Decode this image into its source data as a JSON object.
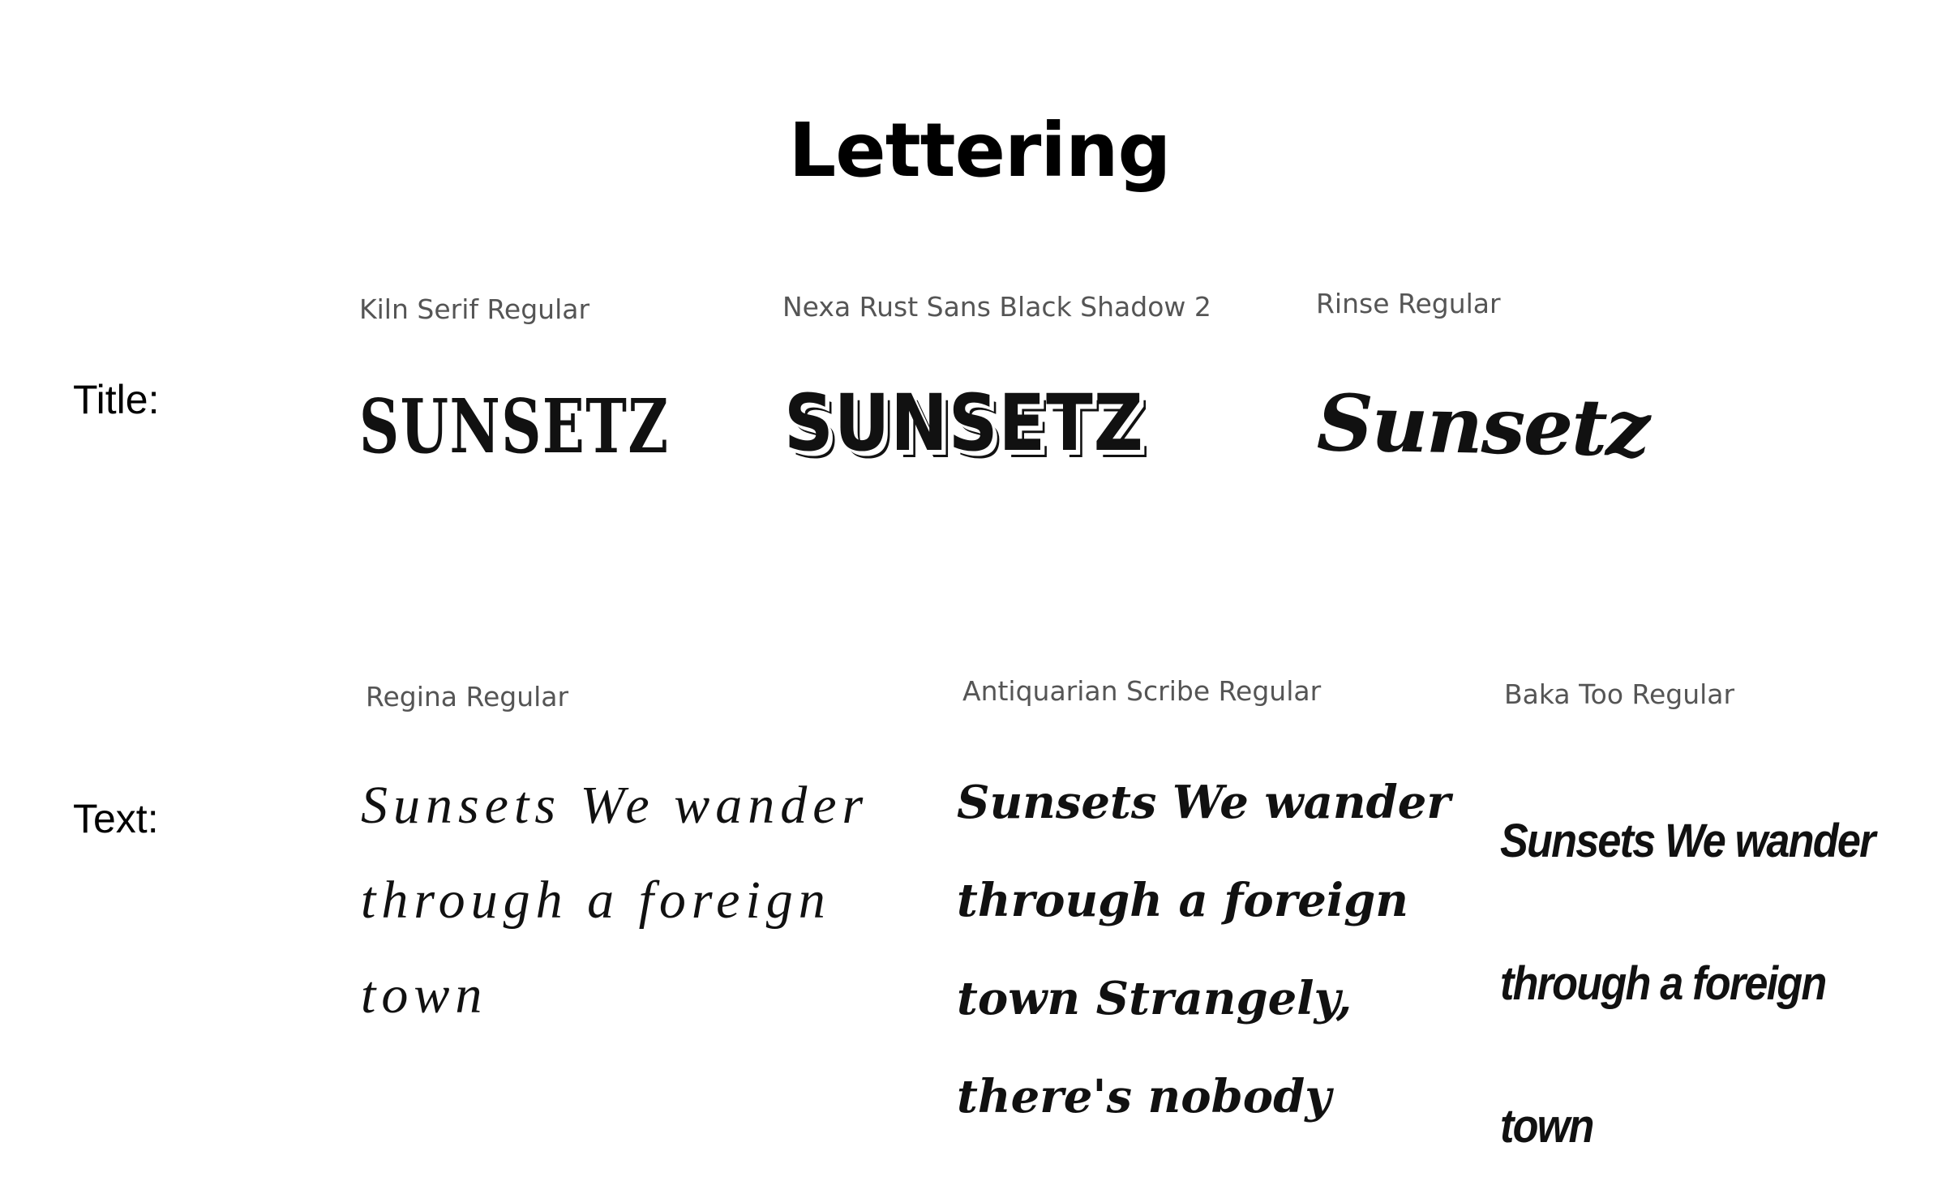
{
  "title": "Lettering",
  "rows": {
    "title_row": {
      "label": "Title:",
      "fonts": [
        {
          "name": "Kiln Serif Regular",
          "sample": "SUNSETZ"
        },
        {
          "name": "Nexa Rust Sans Black Shadow 2",
          "sample": "SUNSETZ"
        },
        {
          "name": "Rinse Regular",
          "sample": "Sunsetz"
        }
      ]
    },
    "text_row": {
      "label": "Text:",
      "fonts": [
        {
          "name": "Regina Regular",
          "sample": "Sunsets We wander through a foreign town"
        },
        {
          "name": "Antiquarian Scribe Regular",
          "sample": "Sunsets We wander through a foreign town Strangely, there's nobody"
        },
        {
          "name": "Baka Too Regular",
          "sample": "Sunsets We wander through a foreign town"
        }
      ]
    }
  }
}
